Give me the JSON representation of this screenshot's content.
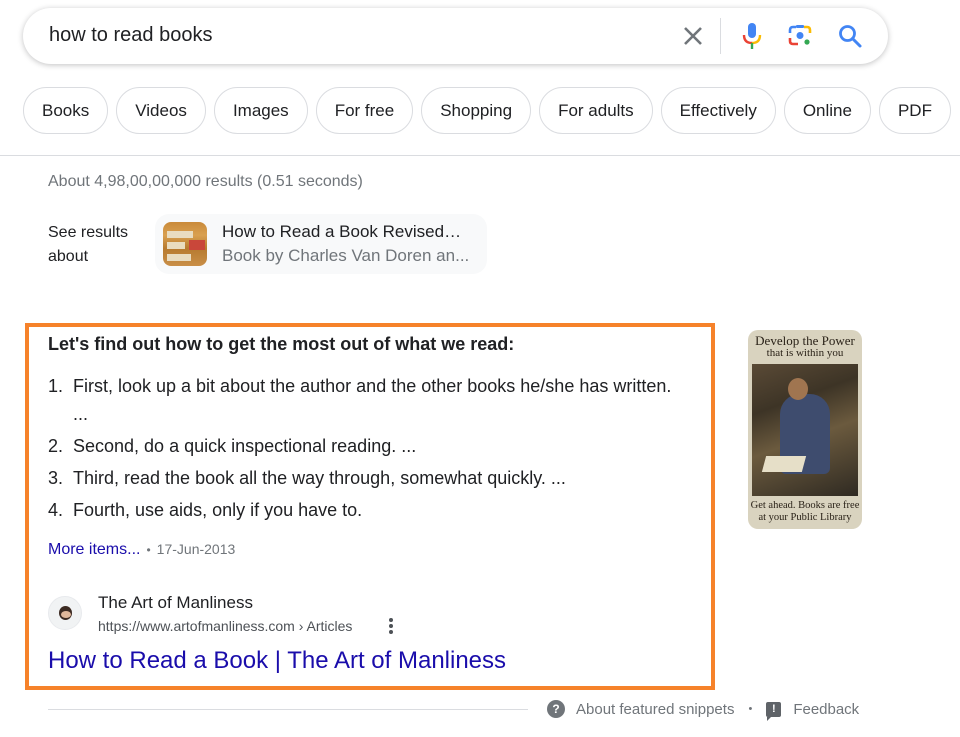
{
  "search": {
    "query": "how to read books",
    "icons": [
      "close-icon",
      "microphone-icon",
      "google-lens-icon",
      "search-icon"
    ]
  },
  "chips": [
    "Books",
    "Videos",
    "Images",
    "For free",
    "Shopping",
    "For adults",
    "Effectively",
    "Online",
    "PDF"
  ],
  "result_stats": "About 4,98,00,00,000 results (0.51 seconds)",
  "see_results": {
    "label": "See results about",
    "card_title": "How to Read a Book Revised…",
    "card_subtitle": "Book by Charles Van Doren an..."
  },
  "snippet": {
    "heading": "Let's find out how to get the most out of what we read:",
    "items": [
      {
        "num": "1.",
        "text": "First, look up a bit about the author and the other books he/she has written. ..."
      },
      {
        "num": "2.",
        "text": "Second, do a quick inspectional reading. ..."
      },
      {
        "num": "3.",
        "text": "Third, read the book all the way through, somewhat quickly. ..."
      },
      {
        "num": "4.",
        "text": "Fourth, use aids, only if you have to."
      }
    ],
    "more_items": "More items...",
    "separator": "•",
    "date": "17-Jun-2013",
    "source": {
      "site_name": "The Art of Manliness",
      "url": "https://www.artofmanliness.com › Articles",
      "title": "How to Read a Book | The Art of Manliness"
    },
    "image": {
      "top_line1": "Develop the Power",
      "top_line2": "that is within you",
      "bottom_line1": "Get ahead. Books are free",
      "bottom_line2": "at your Public Library"
    },
    "highlight_color": "#f6822a"
  },
  "footer": {
    "about": "About featured snippets",
    "separator": "•",
    "feedback": "Feedback"
  },
  "colors": {
    "link": "#1a0dab",
    "muted": "#70757a",
    "text": "#202124"
  }
}
